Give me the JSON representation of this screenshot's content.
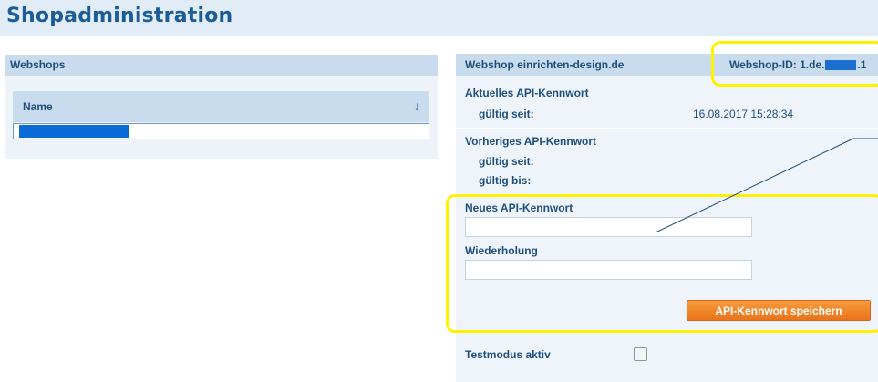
{
  "page": {
    "title": "Shopadministration"
  },
  "webshops_panel": {
    "header": "Webshops",
    "columns": [
      {
        "label": "Name",
        "sort_indicator": "↓"
      }
    ],
    "rows": [
      {
        "name": "[redacted]"
      }
    ]
  },
  "detail_panel": {
    "header": "Webshop einrichten-design.de",
    "shop_id_prefix": "Webshop-ID: 1.de.",
    "shop_id_suffix": ".1",
    "current_password": {
      "heading": "Aktuelles API-Kennwort",
      "valid_since_label": "gültig seit:",
      "valid_since_value": "16.08.2017 15:28:34"
    },
    "previous_password": {
      "heading": "Vorheriges API-Kennwort",
      "valid_since_label": "gültig seit:",
      "valid_until_label": "gültig bis:"
    },
    "new_password": {
      "label": "Neues API-Kennwort",
      "value": ""
    },
    "repeat_password": {
      "label": "Wiederholung",
      "value": ""
    },
    "save_button": "API-Kennwort speichern",
    "test_mode": {
      "label": "Testmodus aktiv",
      "checked": false
    }
  },
  "colors": {
    "title_bar": "#e1ecf7",
    "panel_header": "#c9dced",
    "panel_body": "#edf3f9",
    "text": "#1e4f7d",
    "button": "#ef8428",
    "highlight": "#fff200",
    "redaction": "#0a6ad6"
  }
}
